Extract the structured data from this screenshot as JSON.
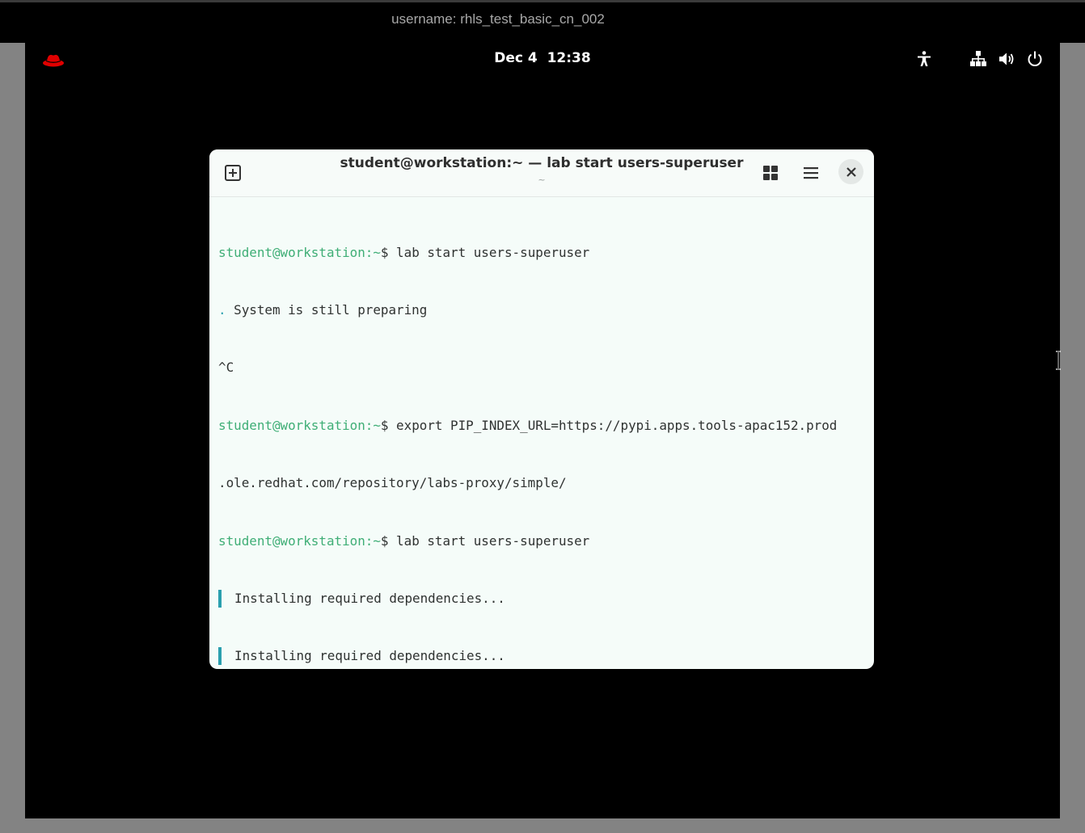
{
  "banner": {
    "username_text": "username: rhls_test_basic_cn_002"
  },
  "topbar": {
    "clock_date": "Dec 4",
    "clock_time": "12:38",
    "icons": [
      "redhat-logo",
      "accessibility-icon",
      "network-icon",
      "volume-icon",
      "power-icon"
    ]
  },
  "terminal": {
    "title": "student@workstation:~ — lab start users-superuser",
    "subtitle": "~",
    "lines": [
      {
        "prompt": "student@workstation:",
        "path": "~",
        "cmd": "$ lab start users-superuser"
      },
      {
        "marker": ".",
        "text": " System is still preparing"
      },
      {
        "text": "^C"
      },
      {
        "prompt": "student@workstation:",
        "path": "~",
        "cmd": "$ export PIP_INDEX_URL=https://pypi.apps.tools-apac152.prod"
      },
      {
        "text": ".ole.redhat.com/repository/labs-proxy/simple/"
      },
      {
        "prompt": "student@workstation:",
        "path": "~",
        "cmd": "$ lab start users-superuser"
      },
      {
        "text": "Installing required dependencies..."
      },
      {
        "text": "Installing required dependencies..."
      }
    ]
  },
  "colors": {
    "prompt": "#3fae76",
    "progress_bar": "#2a9fae",
    "redhat": "#e00000"
  }
}
